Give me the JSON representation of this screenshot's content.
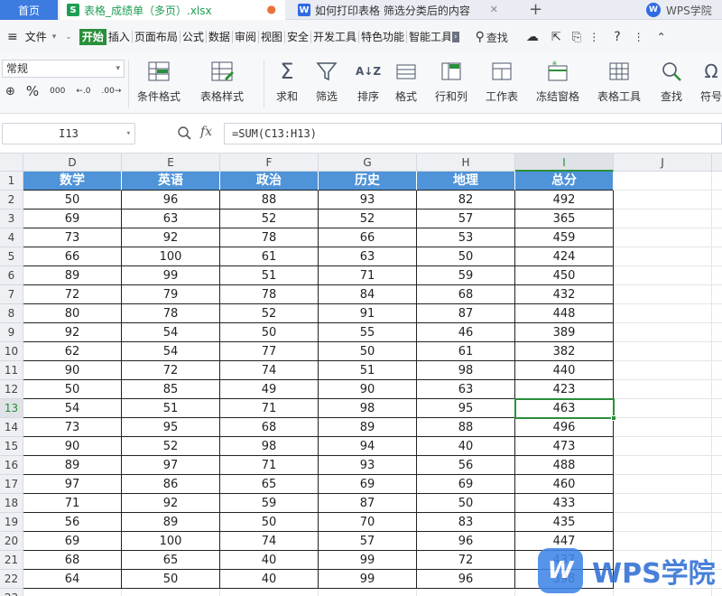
{
  "tabs": {
    "home": "首页",
    "file1": "表格_成绩单（多页）.xlsx",
    "file2": "如何打印表格 筛选分类后的内容",
    "add": "+",
    "academy": "WPS学院"
  },
  "menu": {
    "file": "文件",
    "items": [
      "开始",
      "插入",
      "页面布局",
      "公式",
      "数据",
      "审阅",
      "视图",
      "安全",
      "开发工具",
      "特色功能",
      "智能工具"
    ],
    "search": "查找"
  },
  "ribbon": {
    "number_format": "常规",
    "percent": "%",
    "buttons": [
      {
        "label": "条件格式",
        "icon": "conditional-format-icon"
      },
      {
        "label": "表格样式",
        "icon": "table-style-icon"
      },
      {
        "label": "求和",
        "icon": "sum-icon"
      },
      {
        "label": "筛选",
        "icon": "filter-icon"
      },
      {
        "label": "排序",
        "icon": "sort-icon"
      },
      {
        "label": "格式",
        "icon": "format-icon"
      },
      {
        "label": "行和列",
        "icon": "rows-cols-icon"
      },
      {
        "label": "工作表",
        "icon": "worksheet-icon"
      },
      {
        "label": "冻结窗格",
        "icon": "freeze-panes-icon"
      },
      {
        "label": "表格工具",
        "icon": "table-tools-icon"
      },
      {
        "label": "查找",
        "icon": "find-icon"
      },
      {
        "label": "符号",
        "icon": "symbol-icon"
      }
    ]
  },
  "formula_bar": {
    "name_box": "I13",
    "fx": "fx",
    "formula": "=SUM(C13:H13)"
  },
  "sheet": {
    "columns": [
      "D",
      "E",
      "F",
      "G",
      "H",
      "I",
      "J",
      "K"
    ],
    "selected_column": "I",
    "selected_row": "13",
    "header_row": [
      "数学",
      "英语",
      "政治",
      "历史",
      "地理",
      "总分"
    ],
    "row_numbers": [
      "1",
      "2",
      "3",
      "4",
      "5",
      "6",
      "7",
      "8",
      "9",
      "10",
      "11",
      "12",
      "13",
      "14",
      "15",
      "16",
      "17",
      "18",
      "19",
      "20",
      "21",
      "22",
      "23"
    ],
    "rows": [
      [
        "50",
        "96",
        "88",
        "93",
        "82",
        "492"
      ],
      [
        "69",
        "63",
        "52",
        "52",
        "57",
        "365"
      ],
      [
        "73",
        "92",
        "78",
        "66",
        "53",
        "459"
      ],
      [
        "66",
        "100",
        "61",
        "63",
        "50",
        "424"
      ],
      [
        "89",
        "99",
        "51",
        "71",
        "59",
        "450"
      ],
      [
        "72",
        "79",
        "78",
        "84",
        "68",
        "432"
      ],
      [
        "80",
        "78",
        "52",
        "91",
        "87",
        "448"
      ],
      [
        "92",
        "54",
        "50",
        "55",
        "46",
        "389"
      ],
      [
        "62",
        "54",
        "77",
        "50",
        "61",
        "382"
      ],
      [
        "90",
        "72",
        "74",
        "51",
        "98",
        "440"
      ],
      [
        "50",
        "85",
        "49",
        "90",
        "63",
        "423"
      ],
      [
        "54",
        "51",
        "71",
        "98",
        "95",
        "463"
      ],
      [
        "73",
        "95",
        "68",
        "89",
        "88",
        "496"
      ],
      [
        "90",
        "52",
        "98",
        "94",
        "40",
        "473"
      ],
      [
        "89",
        "97",
        "71",
        "93",
        "56",
        "488"
      ],
      [
        "97",
        "86",
        "65",
        "69",
        "69",
        "460"
      ],
      [
        "71",
        "92",
        "59",
        "87",
        "50",
        "433"
      ],
      [
        "56",
        "89",
        "50",
        "70",
        "83",
        "435"
      ],
      [
        "69",
        "100",
        "74",
        "57",
        "96",
        "447"
      ],
      [
        "68",
        "65",
        "40",
        "99",
        "72",
        "437"
      ],
      [
        "64",
        "50",
        "40",
        "99",
        "96",
        "398"
      ]
    ]
  },
  "watermark": {
    "logo": "W",
    "text": "WPS学院"
  }
}
